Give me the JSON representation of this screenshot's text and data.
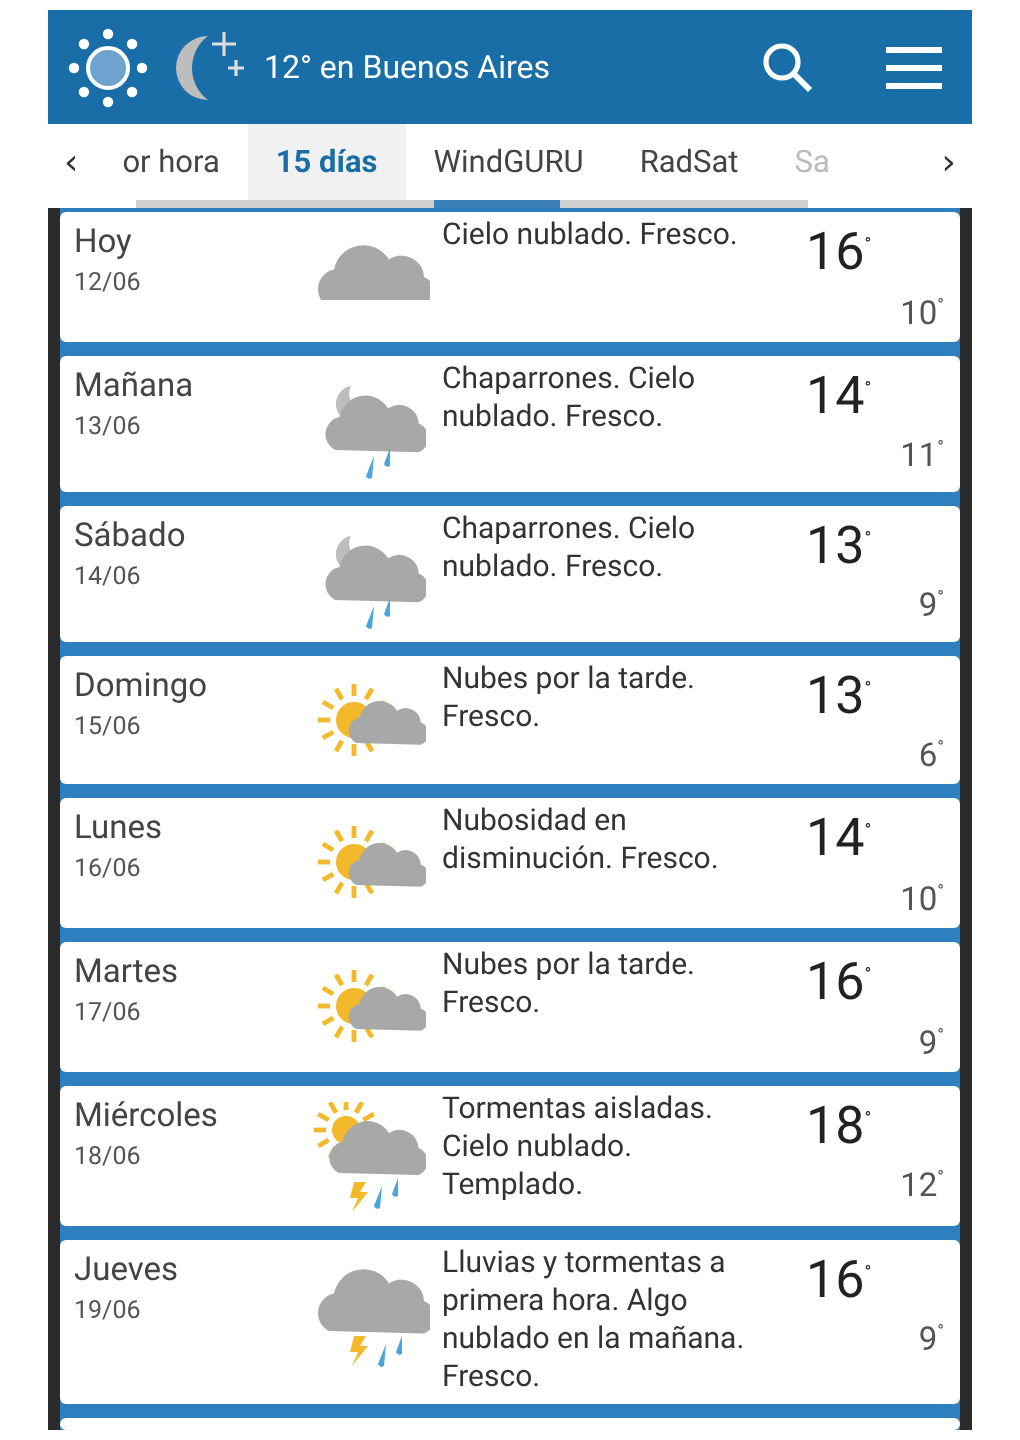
{
  "header": {
    "title": "12° en Buenos Aires"
  },
  "tab_arrows": {
    "previous": "‹",
    "next": "›"
  },
  "tabs": [
    {
      "label": "or hora",
      "selected": false
    },
    {
      "label": "15 días",
      "selected": true
    },
    {
      "label": "WindGURU",
      "selected": false
    },
    {
      "label": "RadSat",
      "selected": false
    },
    {
      "label": "Sa",
      "selected": false
    }
  ],
  "forecast": [
    {
      "day": "Hoy",
      "date": "12/06",
      "kind": "cloud",
      "description": "Cielo nublado. Fresco.",
      "max": "16$^{°}$",
      "min": "10$^{°}$"
    },
    {
      "day": "Mañana",
      "date": "13/06",
      "kind": "night-showers",
      "description": "Chaparrones. Cielo nublado. Fresco.",
      "max": "14$^{°}$",
      "min": "11$^{°}$"
    },
    {
      "day": "Sábado",
      "date": "14/06",
      "kind": "night-showers",
      "description": "Chaparrones. Cielo nublado. Fresco.",
      "max": "13$^{°}$",
      "min": "9$^{°}$"
    },
    {
      "day": "Domingo",
      "date": "15/06",
      "kind": "sun-cloud",
      "description": "Nubes por la tarde. Fresco.",
      "max": "13$^{°}$",
      "min": "6$^{°}$"
    },
    {
      "day": "Lunes",
      "date": "16/06",
      "kind": "sun-cloud",
      "description": "Nubosidad en disminución. Fresco.",
      "max": "14$^{°}$",
      "min": "10$^{°}$"
    },
    {
      "day": "Martes",
      "date": "17/06",
      "kind": "sun-cloud",
      "description": "Nubes por la tarde. Fresco.",
      "max": "16$^{°}$",
      "min": "9$^{°}$"
    },
    {
      "day": "Miércoles",
      "date": "18/06",
      "kind": "sun-storm",
      "description": "Tormentas aisladas. Cielo nublado. Templado.",
      "max": "18$^{°}$",
      "min": "12$^{°}$"
    },
    {
      "day": "Jueves",
      "date": "19/06",
      "kind": "storm",
      "description": "Lluvias y tormentas a primera hora. Algo nublado en la mañana. Fresco.",
      "max": "16$^{°}$",
      "min": "9$^{°}$"
    }
  ]
}
